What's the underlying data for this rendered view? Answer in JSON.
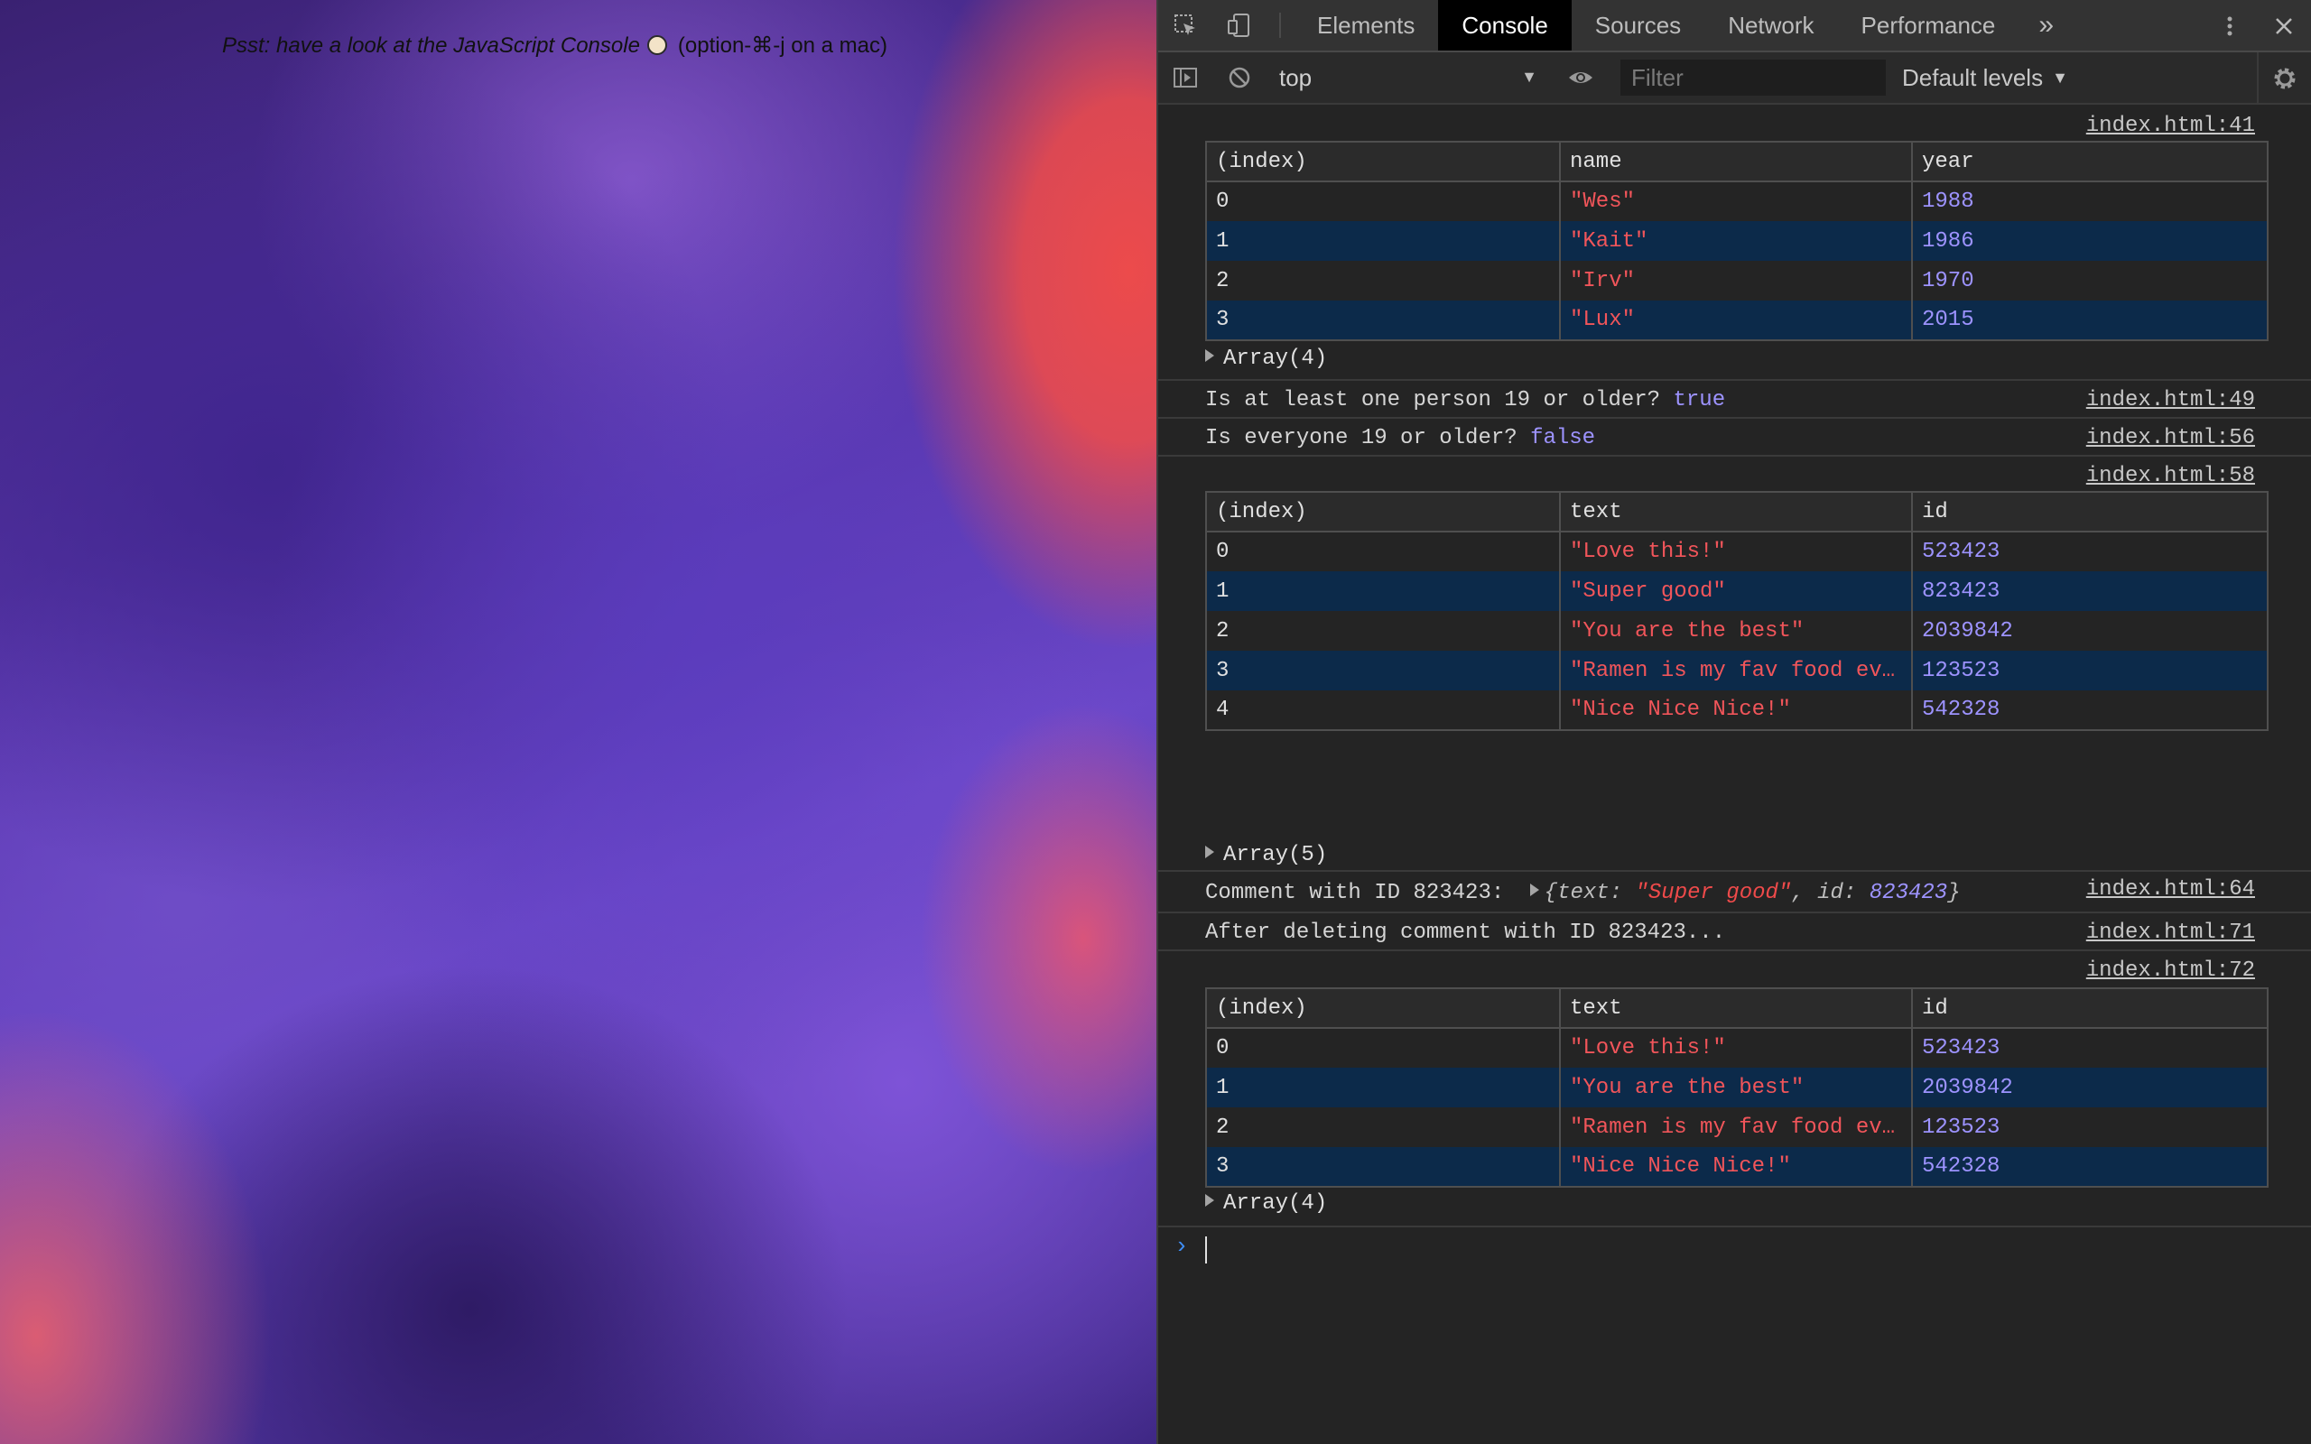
{
  "page": {
    "note_hint": "Psst: have a look at the JavaScript Console",
    "note_shortcut": "(option-⌘-j on a mac)"
  },
  "devtools": {
    "tabs": [
      "Elements",
      "Console",
      "Sources",
      "Network",
      "Performance"
    ],
    "active_tab": "Console",
    "more_tabs": "»",
    "context": "top",
    "filter_placeholder": "Filter",
    "levels": "Default levels"
  },
  "console": {
    "table1": {
      "source": "index.html:41",
      "headers": [
        "(index)",
        "name",
        "year"
      ],
      "rows": [
        [
          "0",
          "\"Wes\"",
          "1988"
        ],
        [
          "1",
          "\"Kait\"",
          "1986"
        ],
        [
          "2",
          "\"Irv\"",
          "1970"
        ],
        [
          "3",
          "\"Lux\"",
          "2015"
        ]
      ],
      "array_label": "Array(4)"
    },
    "log1": {
      "text": "Is at least one person 19 or older?",
      "value": "true",
      "source": "index.html:49"
    },
    "log2": {
      "text": "Is everyone 19 or older?",
      "value": "false",
      "source": "index.html:56"
    },
    "table2": {
      "source": "index.html:58",
      "headers": [
        "(index)",
        "text",
        "id"
      ],
      "rows": [
        [
          "0",
          "\"Love this!\"",
          "523423"
        ],
        [
          "1",
          "\"Super good\"",
          "823423"
        ],
        [
          "2",
          "\"You are the best\"",
          "2039842"
        ],
        [
          "3",
          "\"Ramen is my fav food ev…",
          "123523"
        ],
        [
          "4",
          "\"Nice Nice Nice!\"",
          "542328"
        ]
      ],
      "array_label": "Array(5)"
    },
    "log3": {
      "text": "Comment with ID 823423:",
      "obj_open": "{",
      "key_text": "text:",
      "val_text": "\"Super good\"",
      "sep": ",",
      "key_id": "id:",
      "val_id": "823423",
      "obj_close": "}",
      "source": "index.html:64"
    },
    "log4": {
      "text": "After deleting comment with ID 823423...",
      "source": "index.html:71"
    },
    "table3": {
      "source": "index.html:72",
      "headers": [
        "(index)",
        "text",
        "id"
      ],
      "rows": [
        [
          "0",
          "\"Love this!\"",
          "523423"
        ],
        [
          "1",
          "\"You are the best\"",
          "2039842"
        ],
        [
          "2",
          "\"Ramen is my fav food ev…",
          "123523"
        ],
        [
          "3",
          "\"Nice Nice Nice!\"",
          "542328"
        ]
      ],
      "array_label": "Array(4)"
    },
    "prompt_symbol": "›"
  }
}
